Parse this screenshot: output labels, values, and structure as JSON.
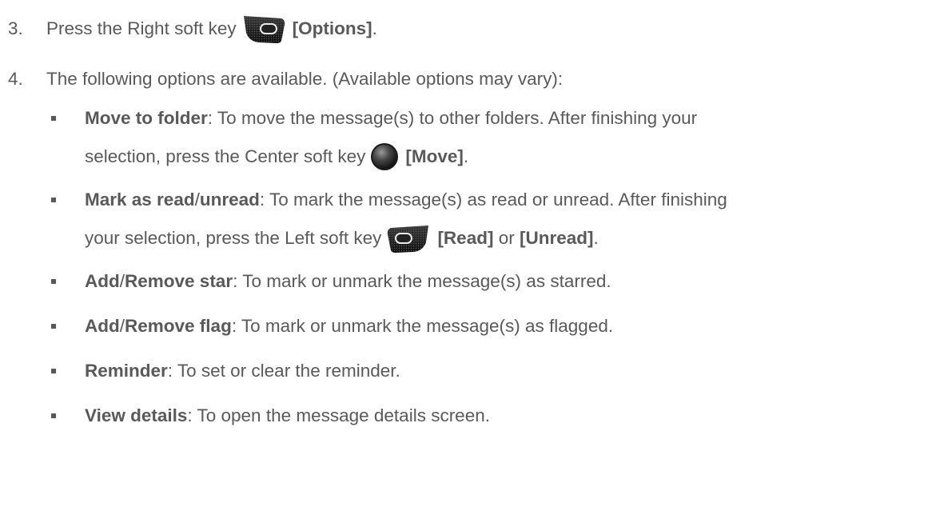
{
  "step3": {
    "num": "3.",
    "text": "Press the Right soft key",
    "key_icon": "right-soft-key-icon",
    "label": "[Options]",
    "end": "."
  },
  "step4": {
    "num": "4.",
    "text": "The following options are available. (Available options may vary):"
  },
  "options": [
    {
      "title": "Move to folder",
      "desc1": ": To move the message(s) to other folders. After finishing your",
      "desc2": "selection, press the Center soft key",
      "key_icon": "center-soft-key-icon",
      "label": "[Move]",
      "end": "."
    },
    {
      "title_a": "Mark as read",
      "sep": "/",
      "title_b": "unread",
      "desc1": ": To mark the message(s) as read or unread. After finishing",
      "desc2": "your selection, press the Left soft key",
      "key_icon": "left-soft-key-icon",
      "label_a": "[Read]",
      "or": " or ",
      "label_b": "[Unread]",
      "end": "."
    },
    {
      "title_a": "Add",
      "sep": "/",
      "title_b": "Remove star",
      "desc": ": To mark or unmark the message(s) as starred."
    },
    {
      "title_a": "Add",
      "sep": "/",
      "title_b": "Remove flag",
      "desc": ": To mark or unmark the message(s) as flagged."
    },
    {
      "title": "Reminder",
      "desc": ": To set or clear the reminder."
    },
    {
      "title": "View details",
      "desc": ": To open the message details screen."
    }
  ]
}
